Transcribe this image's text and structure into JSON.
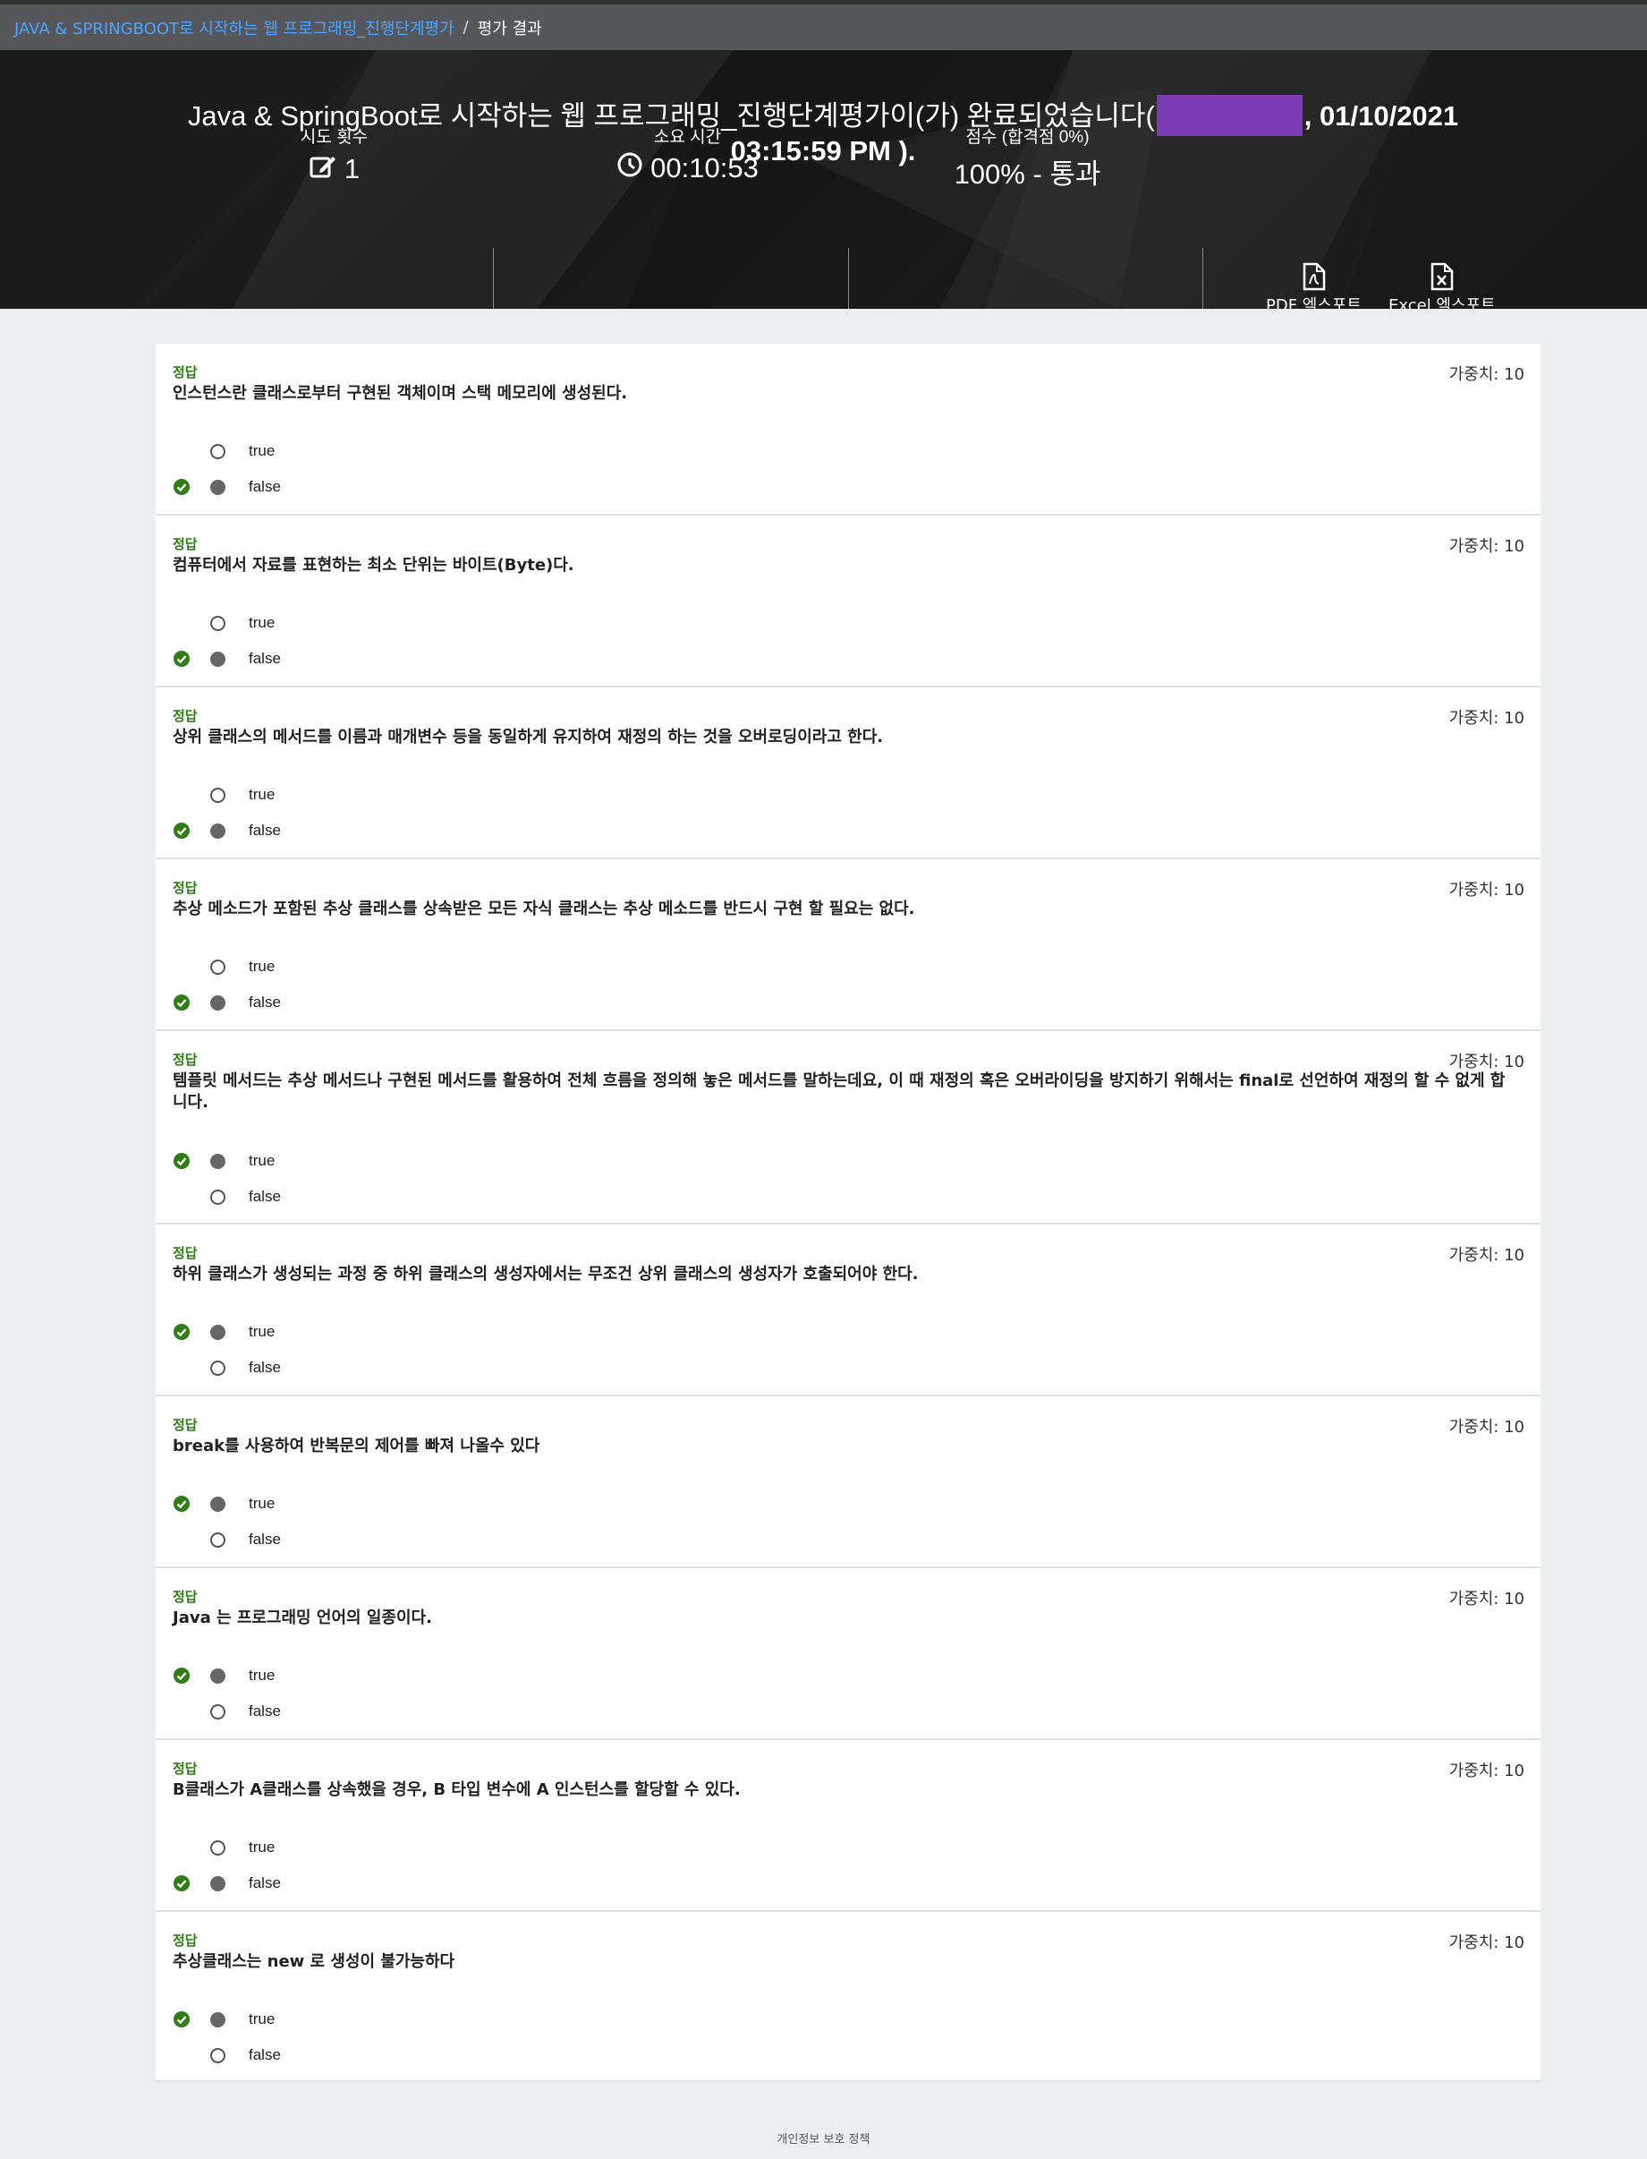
{
  "breadcrumb": {
    "course_link": "JAVA & SPRINGBOOT로 시작하는 웹 프로그래밍_진행단계평가",
    "separator": "/",
    "current": "평가 결과"
  },
  "header": {
    "title_prefix": "Java & SpringBoot로 시작하는 웹 프로그래밍_진행단계평가이(가) 완료되었습니다(",
    "title_date": ", 01/10/2021",
    "title_time": "03:15:59 PM",
    "title_suffix": ").",
    "redaction_color": "#7a3bb5"
  },
  "stats": {
    "attempts_label": "시도 횟수",
    "attempts_value": "1",
    "attempts_icon": "edit-icon",
    "time_label": "소요 시간",
    "time_value": "00:10:53",
    "time_icon": "clock-icon",
    "score_label": "점수 (합격점 0%)",
    "score_value": "100% - 통과",
    "pdf_export_label": "PDF 엑스포트",
    "excel_export_label": "Excel 엑스포트"
  },
  "questions": [
    {
      "status": "정답",
      "weight": "가중치: 10",
      "text": "인스턴스란 클래스로부터 구현된 객체이며 스택 메모리에 생성된다.",
      "options": [
        "true",
        "false"
      ],
      "selected": 1
    },
    {
      "status": "정답",
      "weight": "가중치: 10",
      "text": "컴퓨터에서 자료를 표현하는 최소 단위는 바이트(Byte)다.",
      "options": [
        "true",
        "false"
      ],
      "selected": 1
    },
    {
      "status": "정답",
      "weight": "가중치: 10",
      "text": "상위 클래스의 메서드를 이름과 매개변수 등을 동일하게 유지하여 재정의 하는 것을 오버로딩이라고 한다.",
      "options": [
        "true",
        "false"
      ],
      "selected": 1
    },
    {
      "status": "정답",
      "weight": "가중치: 10",
      "text": "추상 메소드가 포함된 추상 클래스를 상속받은 모든 자식 클래스는 추상 메소드를 반드시 구현 할 필요는 없다.",
      "options": [
        "true",
        "false"
      ],
      "selected": 1
    },
    {
      "status": "정답",
      "weight": "가중치: 10",
      "text": "템플릿 메서드는 추상 메서드나 구현된 메서드를 활용하여 전체 흐름을 정의해 놓은 메서드를 말하는데요, 이 때 재정의 혹은 오버라이딩을 방지하기 위해서는 final로 선언하여 재정의 할 수 없게 합니다.",
      "options": [
        "true",
        "false"
      ],
      "selected": 0
    },
    {
      "status": "정답",
      "weight": "가중치: 10",
      "text": "하위 클래스가 생성되는 과정 중 하위 클래스의 생성자에서는 무조건 상위 클래스의 생성자가 호출되어야 한다.",
      "options": [
        "true",
        "false"
      ],
      "selected": 0
    },
    {
      "status": "정답",
      "weight": "가중치: 10",
      "text": "break를 사용하여 반복문의 제어를 빠져 나올수 있다",
      "options": [
        "true",
        "false"
      ],
      "selected": 0
    },
    {
      "status": "정답",
      "weight": "가중치: 10",
      "text": "Java 는 프로그래밍 언어의 일종이다.",
      "options": [
        "true",
        "false"
      ],
      "selected": 0
    },
    {
      "status": "정답",
      "weight": "가중치: 10",
      "text": "B클래스가 A클래스를 상속했을 경우, B 타입 변수에 A 인스턴스를 할당할 수 있다.",
      "options": [
        "true",
        "false"
      ],
      "selected": 1
    },
    {
      "status": "정답",
      "weight": "가중치: 10",
      "text": "추상클래스는 new 로 생성이 불가능하다",
      "options": [
        "true",
        "false"
      ],
      "selected": 0
    }
  ],
  "footer": {
    "privacy_label": "개인정보 보호 정책"
  },
  "colors": {
    "correct_green": "#2e7d16",
    "link_blue": "#4da3ff"
  }
}
